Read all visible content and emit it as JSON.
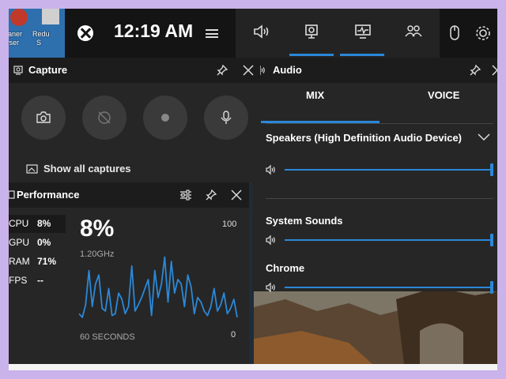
{
  "desktop": {
    "icons": [
      {
        "name": "ccleaner",
        "label": "eaner\nwser"
      },
      {
        "name": "reduce",
        "label": "Redu\n  S"
      }
    ]
  },
  "topbar": {
    "time": "12:19 AM",
    "widgets": [
      "audio",
      "capture",
      "performance",
      "social"
    ]
  },
  "capture": {
    "title": "Capture",
    "show_all": "Show all captures"
  },
  "performance": {
    "title": "Performance",
    "metrics": [
      {
        "name": "CPU",
        "value": "8%"
      },
      {
        "name": "GPU",
        "value": "0%"
      },
      {
        "name": "RAM",
        "value": "71%"
      },
      {
        "name": "FPS",
        "value": "--"
      }
    ],
    "big_value": "8%",
    "frequency": "1.20GHz",
    "max_label": "100",
    "min_label": "0",
    "duration_label": "60 SECONDS",
    "cpu_history": [
      12,
      8,
      22,
      60,
      20,
      45,
      55,
      18,
      15,
      40,
      10,
      12,
      35,
      28,
      12,
      20,
      65,
      15,
      22,
      30,
      40,
      50,
      10,
      60,
      30,
      45,
      75,
      25,
      70,
      35,
      50,
      45,
      20,
      55,
      42,
      12,
      30,
      25,
      15,
      10,
      20,
      40,
      15,
      22,
      35,
      12,
      18,
      28,
      8
    ],
    "accent": "#2b88d8"
  },
  "audio": {
    "title": "Audio",
    "tabs": [
      "MIX",
      "VOICE"
    ],
    "active_tab": "MIX",
    "device": "Speakers (High Definition Audio Device)",
    "device_volume": 1.0,
    "apps": [
      {
        "name": "System Sounds",
        "volume": 1.0
      },
      {
        "name": "Chrome",
        "volume": 1.0
      }
    ]
  }
}
